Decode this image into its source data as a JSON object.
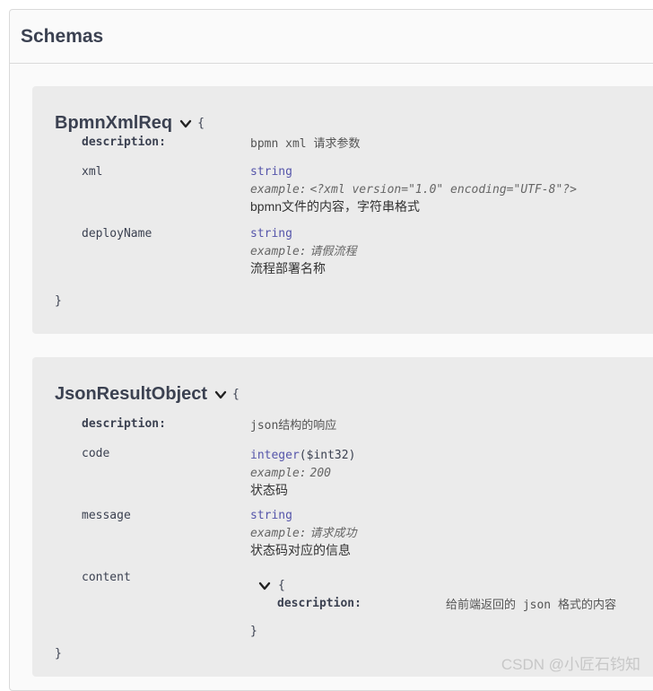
{
  "title": "Schemas",
  "models": [
    {
      "name": "BpmnXmlReq",
      "open_brace": "{",
      "close_brace": "}",
      "description_label": "description:",
      "description": "bpmn xml 请求参数",
      "properties": [
        {
          "name": "xml",
          "type": "string",
          "example_label": "example:",
          "example": "<?xml version=\"1.0\" encoding=\"UTF-8\"?>",
          "description": "bpmn文件的内容，字符串格式"
        },
        {
          "name": "deployName",
          "type": "string",
          "example_label": "example:",
          "example": "请假流程",
          "description": "流程部署名称"
        }
      ]
    },
    {
      "name": "JsonResultObject",
      "open_brace": "{",
      "close_brace": "}",
      "description_label": "description:",
      "description": "json结构的响应",
      "properties": [
        {
          "name": "code",
          "type": "integer",
          "format": "($int32)",
          "example_label": "example:",
          "example": "200",
          "description": "状态码"
        },
        {
          "name": "message",
          "type": "string",
          "example_label": "example:",
          "example": "请求成功",
          "description": "状态码对应的信息"
        },
        {
          "name": "content",
          "nested": {
            "open_brace": "{",
            "close_brace": "}",
            "description_label": "description:",
            "description": "给前端返回的 json 格式的内容"
          }
        }
      ]
    }
  ],
  "watermark": "CSDN @小匠石钧知",
  "icons": {
    "expand": "chevron-down-icon"
  }
}
